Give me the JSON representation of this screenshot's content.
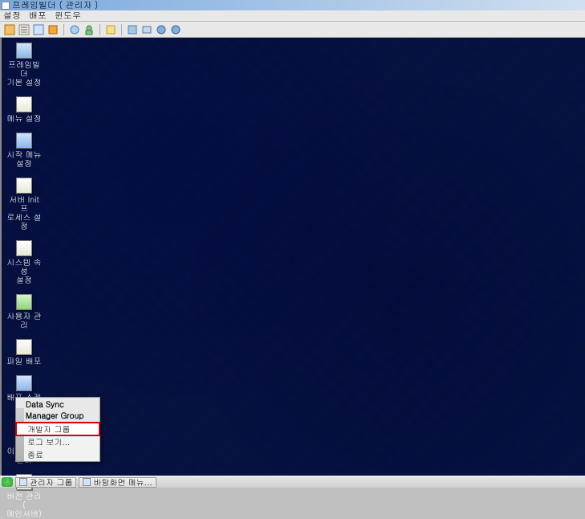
{
  "title": "프레임빌더 ( 관리자 )",
  "menubar": {
    "items": [
      "설정",
      "배포",
      "윈도우"
    ]
  },
  "toolbar_icons": [
    "settings-icon",
    "menu-icon",
    "start-icon",
    "server-icon",
    "system-icon",
    "user-icon",
    "sep",
    "file-icon",
    "sep",
    "schedule-icon",
    "migrate-icon",
    "version-icon",
    "help-icon"
  ],
  "desktop_icons": [
    {
      "label": "프레임빌더\n기본 설정",
      "glyph": "blue",
      "name": "fb-basic-settings"
    },
    {
      "label": "메뉴 설정",
      "glyph": "pale",
      "name": "menu-settings"
    },
    {
      "label": "시작 메뉴\n설정",
      "glyph": "blue",
      "name": "start-menu-settings"
    },
    {
      "label": "서버 Init 프\n로세스 설정",
      "glyph": "pale",
      "name": "server-init-process"
    },
    {
      "label": "시스템 속성\n설정",
      "glyph": "pale",
      "name": "system-properties"
    },
    {
      "label": "사용자 관리",
      "glyph": "green",
      "name": "user-management"
    },
    {
      "label": "파일 배포",
      "glyph": "pale",
      "name": "file-deploy"
    },
    {
      "label": "배포 스케줄\n적용",
      "glyph": "blue",
      "name": "deploy-schedule"
    },
    {
      "label": "이전 서버\n관리",
      "glyph": "blue",
      "name": "migration-server"
    },
    {
      "label": "버전 관리 (\n메인서버)",
      "glyph": "pale",
      "name": "version-control"
    }
  ],
  "context_menu": {
    "title": "Data Sync Manager Group",
    "items": [
      {
        "label": "개발자 그룹",
        "highlight": true,
        "name": "developer-group"
      },
      {
        "label": "로그 보기...",
        "highlight": false,
        "name": "view-log"
      },
      {
        "label": "종료",
        "highlight": false,
        "name": "exit"
      }
    ]
  },
  "taskbar": {
    "buttons": [
      {
        "label": "관리자 그룹",
        "name": "task-admin-group"
      },
      {
        "label": "바탕화면 메뉴...",
        "name": "task-desktop-menu"
      }
    ]
  }
}
